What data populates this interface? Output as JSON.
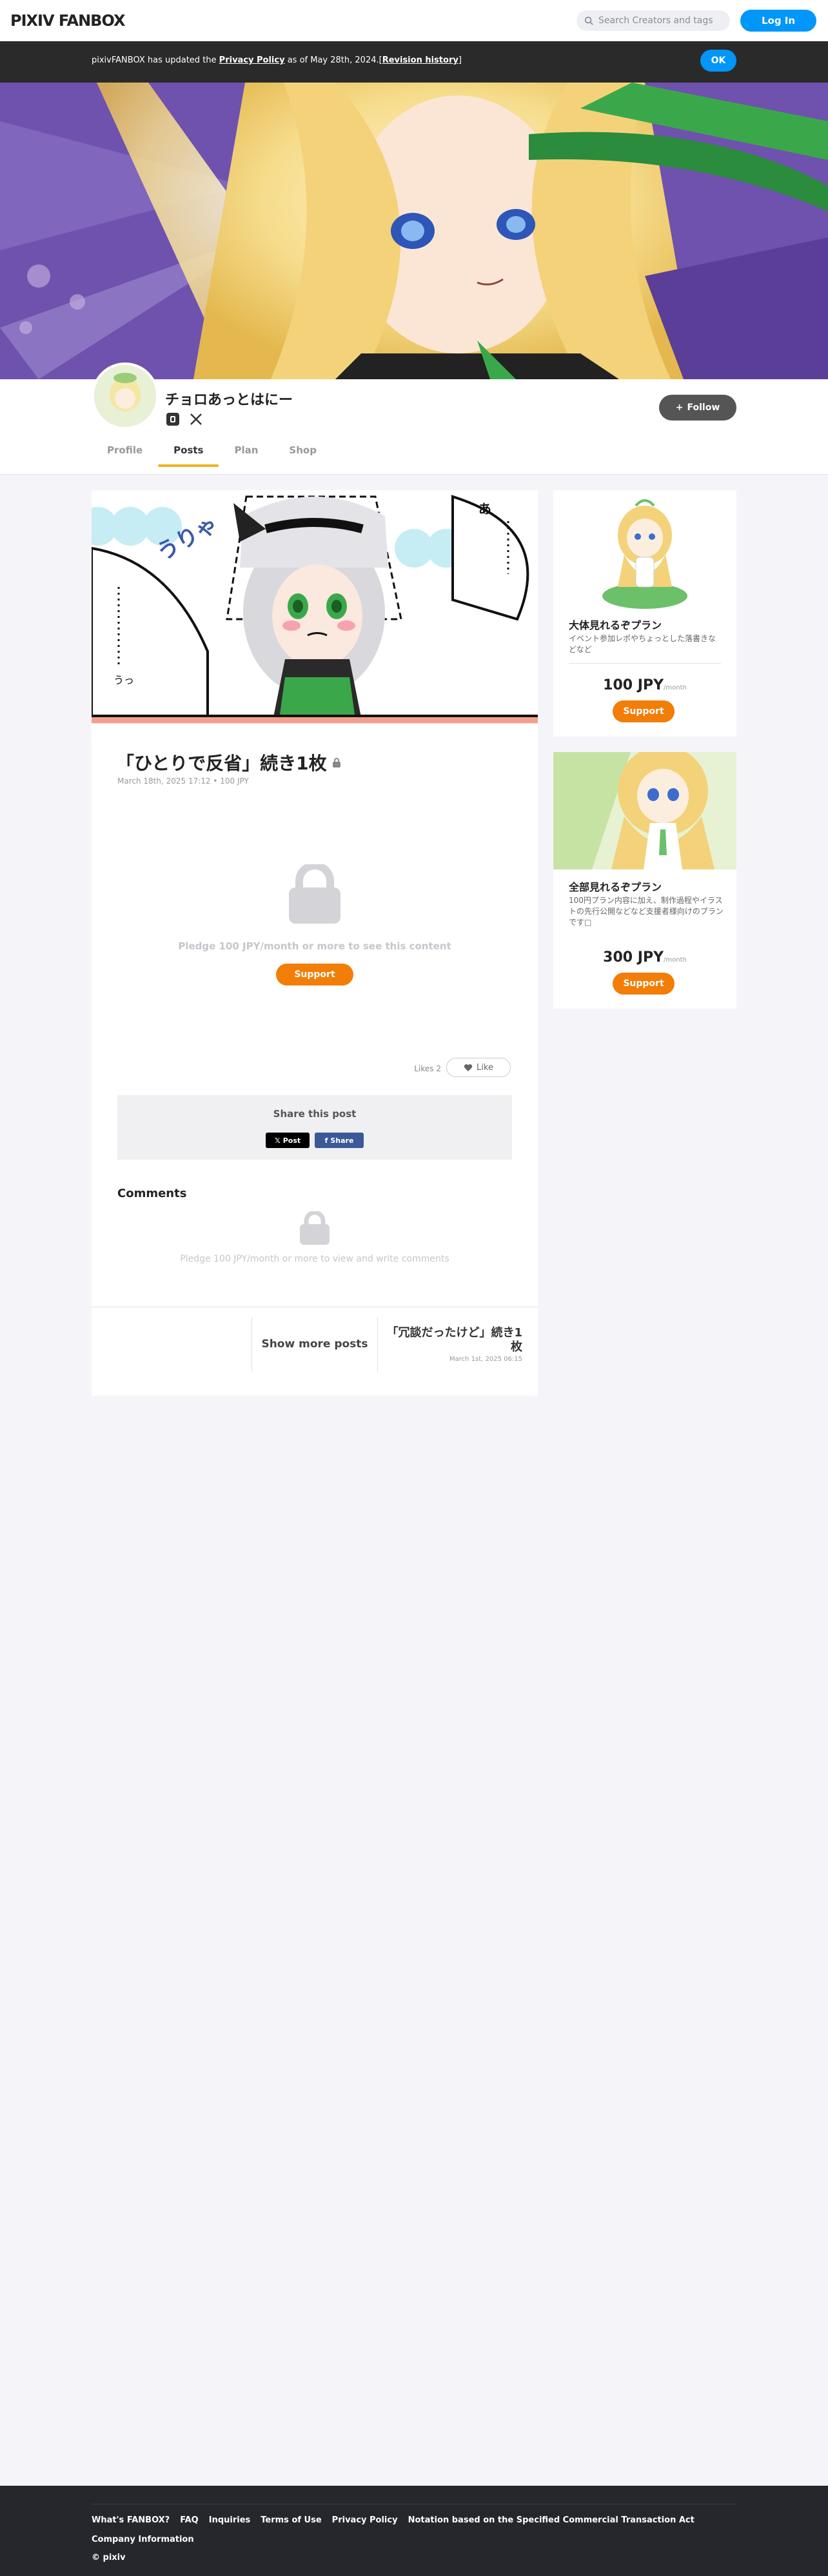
{
  "header": {
    "logo": "PIXIV FANBOX",
    "search_placeholder": "Search Creators and tags",
    "login_label": "Log In"
  },
  "notice": {
    "prefix": "pixivFANBOX has updated the ",
    "policy_link": "Privacy Policy",
    "middle": " as of May 28th, 2024.[",
    "history_link": "Revision history",
    "suffix": "]",
    "ok_label": "OK"
  },
  "creator": {
    "name": "チョロあっとはにー",
    "follow_label": "Follow"
  },
  "tabs": [
    "Profile",
    "Posts",
    "Plan",
    "Shop"
  ],
  "post": {
    "title": "「ひとりで反省」続き1枚",
    "date": "March 18th, 2025 17:12",
    "price": "100 JPY",
    "pledge_text": "Pledge 100 JPY/month or more to see this content",
    "support_label": "Support",
    "likes_label": "Likes",
    "likes_count": "2",
    "like_button": "Like",
    "share_title": "Share this post",
    "x_post": "Post",
    "fb_share": "Share",
    "comments_title": "Comments",
    "comments_pledge": "Pledge 100 JPY/month or more to view and write comments",
    "show_more": "Show more posts",
    "next_title": "「冗談だったけど」続き1枚",
    "next_date": "March 1st, 2025 06:15"
  },
  "plans": [
    {
      "title": "大体見れるぞプラン",
      "desc": "イベント参加レポやちょっとした落書きなどなど",
      "price": "100 JPY",
      "per": "/month",
      "support": "Support"
    },
    {
      "title": "全部見れるぞプラン",
      "desc": "100円プラン内容に加え、制作過程やイラストの先行公開などなど支援者様向けのプランです□",
      "price": "300 JPY",
      "per": "/month",
      "support": "Support"
    }
  ],
  "footer": {
    "links": [
      "What's FANBOX?",
      "FAQ",
      "Inquiries",
      "Terms of Use",
      "Privacy Policy",
      "Notation based on the Specified Commercial Transaction Act"
    ],
    "company": "Company Information",
    "copyright": "© pixiv"
  },
  "colors": {
    "accent_blue": "#0096fa",
    "support_orange": "#f27d07",
    "tab_underline": "#f0b31f"
  }
}
